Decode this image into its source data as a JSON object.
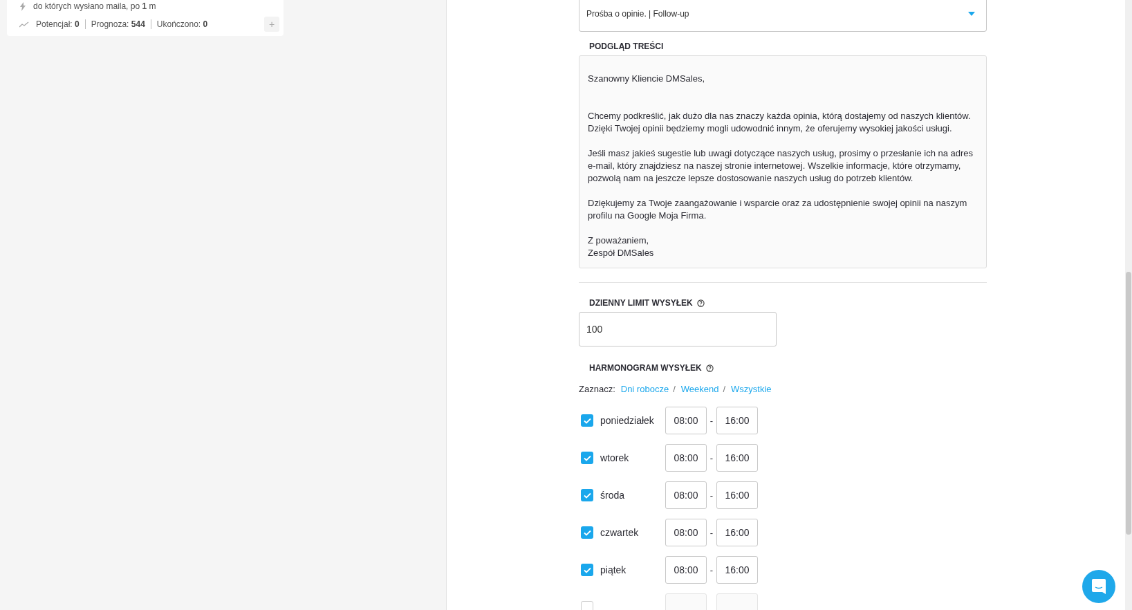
{
  "campaign_card": {
    "trigger": "do których wysłano maila, po **1** m",
    "stats": [
      "Potencjał: **0**",
      "Prognoza: **544**",
      "Ukończono: **0**"
    ],
    "add_label": "+"
  },
  "template_select": {
    "value": "Prośba o opinie. | Follow-up"
  },
  "preview": {
    "heading": "PODGLĄD TREŚCI",
    "paragraphs": [
      {
        "kind": "greeting",
        "lines": [
          "Szanowny Kliencie DMSales,"
        ]
      },
      {
        "kind": "body",
        "lines": [
          "Chcemy podkreślić, jak dużo dla nas znaczy każda opinia, którą dostajemy od naszych klientów.",
          "Dzięki Twojej opinii będziemy mogli udowodnić innym, że oferujemy wysokiej jakości usługi."
        ]
      },
      {
        "kind": "body",
        "lines": [
          "Jeśli masz jakieś sugestie lub uwagi dotyczące naszych usług, prosimy o przesłanie ich na adres",
          "e-mail, który znajdziesz na naszej stronie internetowej. Wszelkie informacje, które otrzymamy,",
          "pozwolą nam na jeszcze lepsze dostosowanie naszych usług do potrzeb klientów."
        ]
      },
      {
        "kind": "body",
        "lines": [
          "Dziękujemy za Twoje zaangażowanie i wsparcie oraz za udostępnienie swojej opinii na naszym",
          "profilu na Google Moja Firma."
        ]
      },
      {
        "kind": "body",
        "lines": [
          "Z poważaniem,",
          "Zespół DMSales"
        ]
      }
    ]
  },
  "daily_limit": {
    "heading": "DZIENNY LIMIT WYSYŁEK",
    "value": "100"
  },
  "schedule": {
    "heading": "HARMONOGRAM WYSYŁEK",
    "select_label": "Zaznacz:",
    "presets": [
      "Dni robocze",
      "Weekend",
      "Wszystkie"
    ],
    "separator": "/",
    "days": [
      {
        "label": "poniedziałek",
        "checked": true,
        "from": "08:00",
        "to": "16:00"
      },
      {
        "label": "wtorek",
        "checked": true,
        "from": "08:00",
        "to": "16:00"
      },
      {
        "label": "środa",
        "checked": true,
        "from": "08:00",
        "to": "16:00"
      },
      {
        "label": "czwartek",
        "checked": true,
        "from": "08:00",
        "to": "16:00"
      },
      {
        "label": "piątek",
        "checked": true,
        "from": "08:00",
        "to": "16:00"
      },
      {
        "checked": false
      }
    ],
    "dash": "-"
  }
}
